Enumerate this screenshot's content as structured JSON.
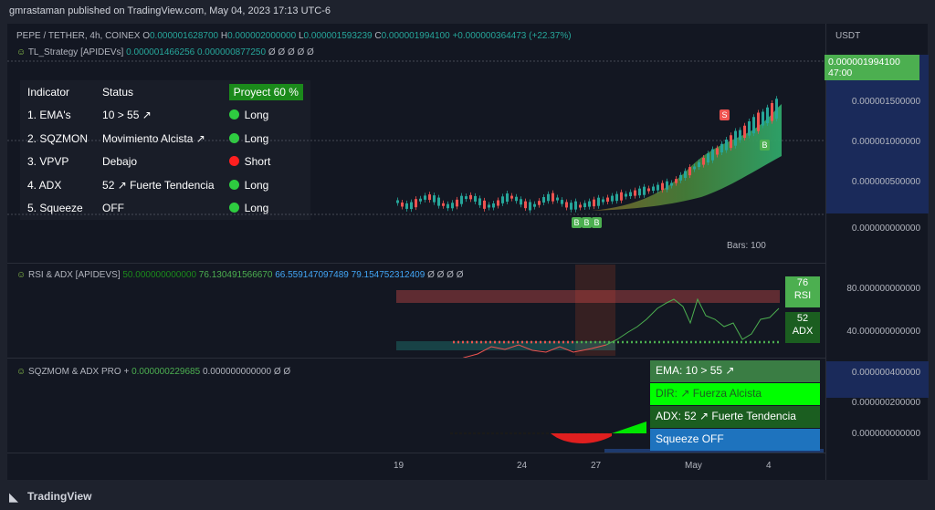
{
  "header": {
    "published": "gmrastaman published on TradingView.com, May 04, 2023 17:13 UTC-6"
  },
  "main_legend": {
    "symbol": "PEPE / TETHER, 4h, COINEX",
    "o_label": "O",
    "o_value": "0.000001628700",
    "h_label": "H",
    "h_value": "0.000002000000",
    "l_label": "L",
    "l_value": "0.000001593239",
    "c_label": "C",
    "c_value": "0.000001994100",
    "change": "+0.000000364473 (+22.37%)",
    "currency": "USDT"
  },
  "strategy_legend": {
    "name": "TL_Strategy [APIDEVs]",
    "v1": "0.000001466256",
    "v2": "0.000000877250",
    "empties": "Ø Ø Ø Ø Ø"
  },
  "indicator_table": {
    "headers": [
      "Indicator",
      "Status",
      "Proyect 60 %"
    ],
    "rows": [
      {
        "name": "1. EMA's",
        "status": "10 > 55 ↗",
        "signal": "Long",
        "color": "#2ecc40"
      },
      {
        "name": "2. SQZMON",
        "status": "Movimiento Alcista ↗",
        "signal": "Long",
        "color": "#2ecc40"
      },
      {
        "name": "3. VPVP",
        "status": "Debajo",
        "signal": "Short",
        "color": "#ff1f1f"
      },
      {
        "name": "4. ADX",
        "status": "52 ↗ Fuerte Tendencia",
        "signal": "Long",
        "color": "#2ecc40"
      },
      {
        "name": "5. Squeeze",
        "status": "OFF",
        "signal": "Long",
        "color": "#2ecc40"
      }
    ]
  },
  "price_axis": {
    "ticks": [
      "0.000001500000",
      "0.000001000000",
      "0.000000500000",
      "0.000000000000"
    ],
    "last_price": "0.000001994100",
    "countdown": "47:00"
  },
  "badges": {
    "b": "B",
    "s": "S"
  },
  "bars_label": "Bars: 100",
  "rsi_pane": {
    "name": "RSI & ADX [APIDEVS]",
    "v1": "50.000000000000",
    "v2": "76.130491566670",
    "v3": "66.559147097489",
    "v4": "79.154752312409",
    "empties": "Ø Ø Ø Ø",
    "ticks": [
      "80.000000000000",
      "40.000000000000"
    ],
    "rsi_value": "76",
    "rsi_label": "RSI",
    "adx_value": "52",
    "adx_label": "ADX"
  },
  "sqz_pane": {
    "name": "SQZMOM & ADX PRO +",
    "v1": "0.000000229685",
    "v2": "0.000000000000",
    "empties": "Ø Ø",
    "ticks": [
      "0.000000400000",
      "0.000000200000",
      "0.000000000000"
    ],
    "boxes": [
      {
        "text": "EMA: 10 > 55 ↗",
        "bg": "#3a7d44",
        "fg": "#ffffff"
      },
      {
        "text": "DIR: ↗ Fuerza Alcista",
        "bg": "#00ff00",
        "fg": "#1b5e20"
      },
      {
        "text": "ADX: 52 ↗ Fuerte Tendencia",
        "bg": "#1b5e20",
        "fg": "#ffffff"
      },
      {
        "text": "Squeeze OFF",
        "bg": "#1e73be",
        "fg": "#ffffff"
      }
    ]
  },
  "time_axis": {
    "ticks": [
      "19",
      "24",
      "27",
      "May",
      "4"
    ]
  },
  "footer": {
    "brand": "TradingView"
  },
  "colors": {
    "up": "#26a69a",
    "down": "#ef5350",
    "accent_green": "#4caf50"
  }
}
